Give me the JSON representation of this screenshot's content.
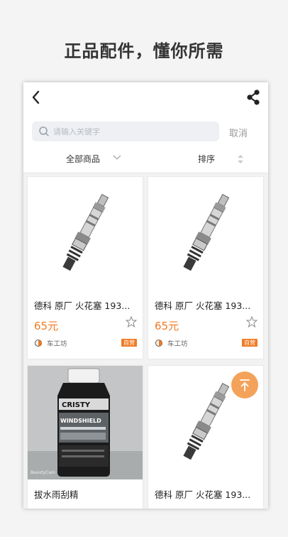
{
  "headline": "正品配件，懂你所需",
  "search": {
    "placeholder": "请输入关键字",
    "cancel_label": "取消"
  },
  "filters": {
    "category_label": "全部商品",
    "sort_label": "排序"
  },
  "products": [
    {
      "name": "德科 原厂 火花塞 193...",
      "price": "65元",
      "shop": "车工坊",
      "tag": "自营",
      "image": "spark-plug"
    },
    {
      "name": "德科 原厂 火花塞 193...",
      "price": "65元",
      "shop": "车工坊",
      "tag": "自营",
      "image": "spark-plug"
    },
    {
      "name": "拔水雨刮精",
      "price": "",
      "shop": "",
      "tag": "",
      "image": "windshield-bottle",
      "bottle_texts": [
        "CRISTY",
        "WINDSHIELD",
        "BeautyCam"
      ]
    },
    {
      "name": "德科 原厂 火花塞 193...",
      "price": "",
      "shop": "",
      "tag": "",
      "image": "spark-plug"
    }
  ]
}
